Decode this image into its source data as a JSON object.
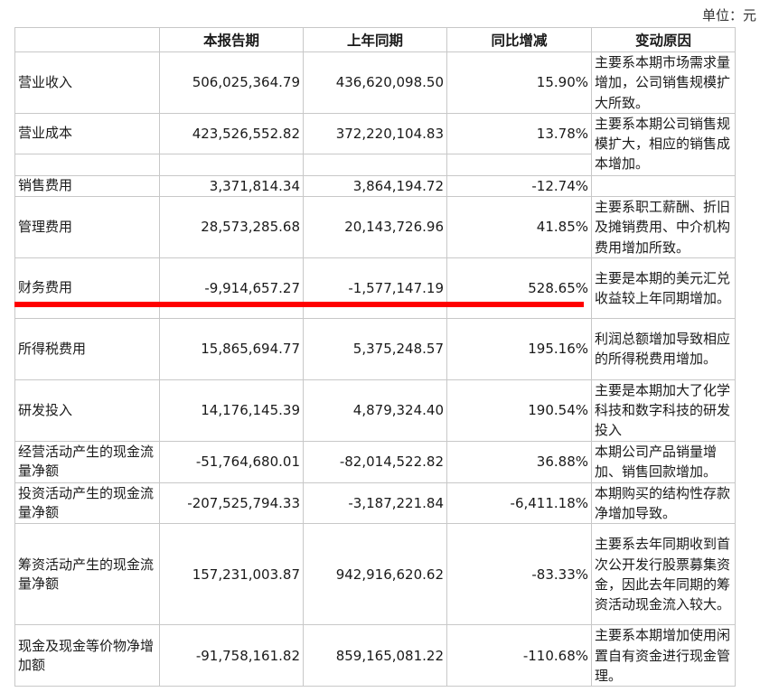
{
  "unit_label": "单位：元",
  "headers": {
    "item": "",
    "current": "本报告期",
    "prior": "上年同期",
    "yoy": "同比增减",
    "reason": "变动原因"
  },
  "rows": [
    {
      "item": "营业收入",
      "current": "506,025,364.79",
      "prior": "436,620,098.50",
      "yoy": "15.90%",
      "reason": "主要系本期市场需求量增加，公司销售规模扩大所致。"
    },
    {
      "item": "营业成本",
      "current": "423,526,552.82",
      "prior": "372,220,104.83",
      "yoy": "13.78%",
      "reason": "主要系本期公司销售规模扩大，相应的销售成本增加。"
    },
    {
      "item": "销售费用",
      "current": "3,371,814.34",
      "prior": "3,864,194.72",
      "yoy": "-12.74%",
      "reason": ""
    },
    {
      "item": "管理费用",
      "current": "28,573,285.68",
      "prior": "20,143,726.96",
      "yoy": "41.85%",
      "reason": "主要系职工薪酬、折旧及摊销费用、中介机构费用增加所致。"
    },
    {
      "item": "财务费用",
      "current": "-9,914,657.27",
      "prior": "-1,577,147.19",
      "yoy": "528.65%",
      "reason": "主要是本期的美元汇兑收益较上年同期增加。"
    },
    {
      "item": "所得税费用",
      "current": "15,865,694.77",
      "prior": "5,375,248.57",
      "yoy": "195.16%",
      "reason": "利润总额增加导致相应的所得税费用增加。"
    },
    {
      "item": "研发投入",
      "current": "14,176,145.39",
      "prior": "4,879,324.40",
      "yoy": "190.54%",
      "reason": "主要是本期加大了化学科技和数字科技的研发投入"
    },
    {
      "item": "经营活动产生的现金流量净额",
      "current": "-51,764,680.01",
      "prior": "-82,014,522.82",
      "yoy": "36.88%",
      "reason": "本期公司产品销量增加、销售回款增加。"
    },
    {
      "item": "投资活动产生的现金流量净额",
      "current": "-207,525,794.33",
      "prior": "-3,187,221.84",
      "yoy": "-6,411.18%",
      "reason": "本期购买的结构性存款净增加导致。"
    },
    {
      "item": "筹资活动产生的现金流量净额",
      "current": "157,231,003.87",
      "prior": "942,916,620.62",
      "yoy": "-83.33%",
      "reason": "主要系去年同期收到首次公开发行股票募集资金，因此去年同期的筹资活动现金流入较大。"
    },
    {
      "item": "现金及现金等价物净增加额",
      "current": "-91,758,161.82",
      "prior": "859,165,081.22",
      "yoy": "-110.68%",
      "reason": "主要系本期增加使用闲置自有资金进行现金管理。"
    }
  ]
}
